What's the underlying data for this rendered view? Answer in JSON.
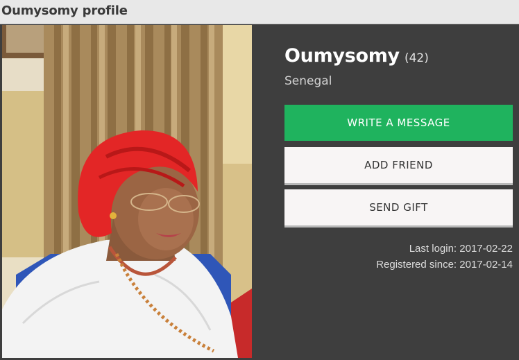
{
  "page": {
    "title": "Oumysomy profile"
  },
  "profile": {
    "name": "Oumysomy",
    "age": "(42)",
    "country": "Senegal"
  },
  "actions": {
    "message_label": "WRITE A MESSAGE",
    "friend_label": "ADD FRIEND",
    "gift_label": "SEND GIFT"
  },
  "meta": {
    "last_login": "Last login: 2017-02-22",
    "registered": "Registered since: 2017-02-14"
  },
  "colors": {
    "accent": "#1fb35e",
    "panel_background": "#3e3e3e",
    "title_bar": "#e8e8e8"
  }
}
